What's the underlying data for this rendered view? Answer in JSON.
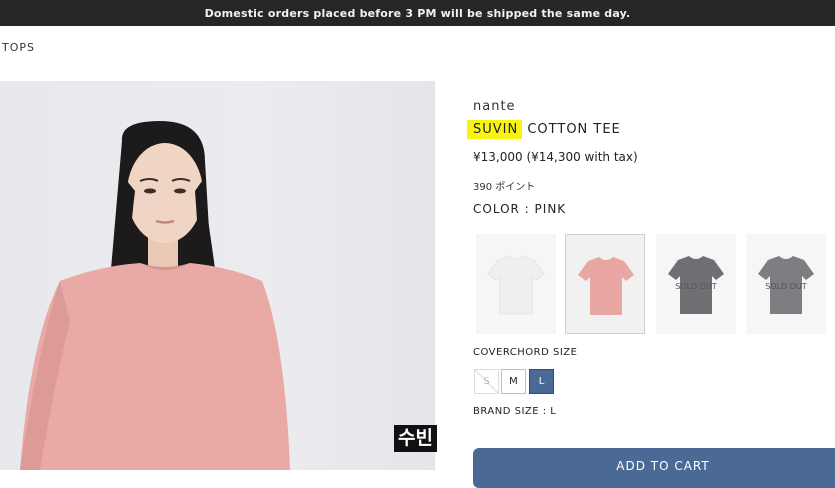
{
  "announcement": "Domestic orders placed before 3 PM will be shipped the same day.",
  "breadcrumb": "TOPS",
  "caption": "수빈",
  "product": {
    "brand": "nante",
    "name_highlight": "SUVIN",
    "name_rest": " COTTON TEE",
    "price": "¥13,000 (¥14,300 with tax)",
    "points": "390 ポイント",
    "color_label": "COLOR : PINK",
    "color_swatches": [
      {
        "color_name": "WHITE",
        "shirt_color": "#f1efed",
        "status": ""
      },
      {
        "color_name": "PINK",
        "shirt_color": "#e9a7a4",
        "status": "",
        "selected": true
      },
      {
        "color_name": "CHARCOAL",
        "shirt_color": "#6f7074",
        "status": "SOLD OUT"
      },
      {
        "color_name": "GRAY",
        "shirt_color": "#7d7e82",
        "status": "SOLD OUT"
      }
    ],
    "size_label": "COVERCHORD SIZE",
    "sizes": [
      {
        "label": "S",
        "state": "disabled"
      },
      {
        "label": "M",
        "state": "available"
      },
      {
        "label": "L",
        "state": "selected"
      }
    ],
    "brand_size": "BRAND SIZE : L",
    "cart_label": "ADD TO CART",
    "accent_color": "#4a6a95"
  }
}
